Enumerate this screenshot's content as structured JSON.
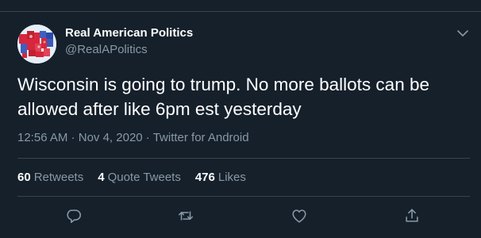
{
  "user": {
    "display_name": "Real American Politics",
    "handle": "@RealAPolitics",
    "avatar_icon": "us-election-map-icon"
  },
  "tweet": {
    "text": "Wisconsin is going to trump. No more ballots can be allowed after like 6pm est yesterday",
    "time": "12:56 AM",
    "date": "Nov 4, 2020",
    "source": "Twitter for Android"
  },
  "stats": {
    "retweets_count": "60",
    "retweets_label": "Retweets",
    "quotes_count": "4",
    "quotes_label": "Quote Tweets",
    "likes_count": "476",
    "likes_label": "Likes"
  },
  "actions": [
    "reply-icon",
    "retweet-icon",
    "like-icon",
    "share-icon"
  ],
  "colors": {
    "background": "#15202b",
    "text": "#ffffff",
    "secondary": "#8899a6",
    "divider": "#38444d"
  }
}
